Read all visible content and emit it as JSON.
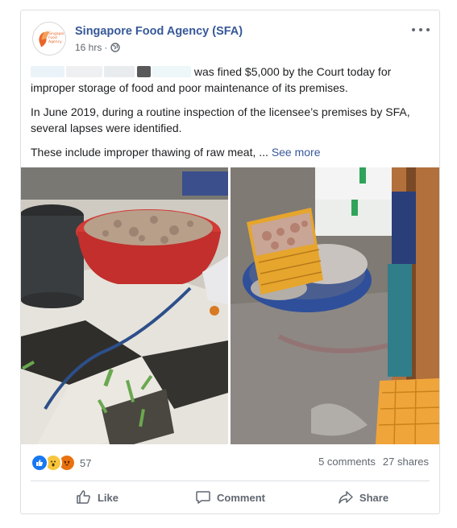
{
  "post": {
    "page_name": "Singapore Food Agency (SFA)",
    "time": "16 hrs",
    "avatar_text": "Singapore Food Agency",
    "privacy_icon": "globe-icon",
    "more_icon": "more-options-icon",
    "paragraph_1": "was fined $5,000 by the Court today for improper storage of food and poor maintenance of its premises.",
    "paragraph_2": "In June 2019, during a routine inspection of the licensee’s premises by SFA, several lapses were identified.",
    "paragraph_3": "These include improper thawing of raw meat, ...",
    "see_more": "See more"
  },
  "reactions": {
    "icons": [
      "like-reaction-icon",
      "wow-reaction-icon",
      "angry-reaction-icon"
    ],
    "count": "57"
  },
  "stats": {
    "comments": "5 comments",
    "shares": "27 shares"
  },
  "actions": {
    "like": "Like",
    "comment": "Comment",
    "share": "Share"
  },
  "colors": {
    "link": "#365899",
    "meta": "#616770",
    "like_blue": "#1877f2"
  }
}
